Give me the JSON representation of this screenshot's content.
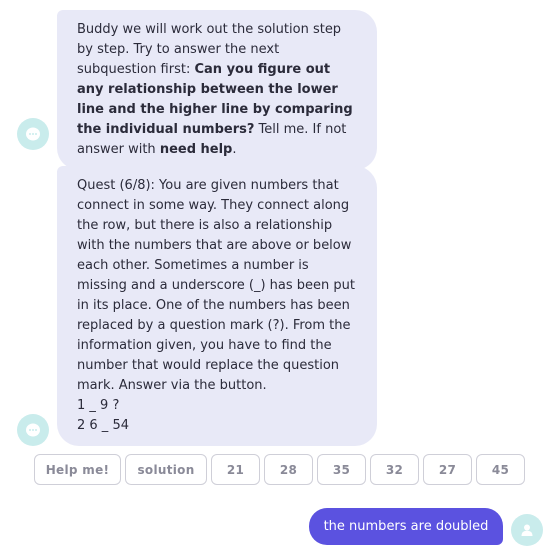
{
  "messages": [
    {
      "sender": "bot",
      "segments": [
        {
          "text": "Buddy we will work out the solution step by step. Try to answer the next subquestion first: ",
          "bold": false
        },
        {
          "text": "Can you figure out any relationship between the lower line and the higher line by comparing the individual numbers?",
          "bold": true
        },
        {
          "text": " Tell me. If not answer with ",
          "bold": false
        },
        {
          "text": "need help",
          "bold": true
        },
        {
          "text": ".",
          "bold": false
        }
      ]
    },
    {
      "sender": "bot",
      "body": "Quest (6/8): You are given numbers that connect in some way. They connect along the row, but there is also a relationship with the numbers that are above or below each other. Sometimes a number is missing and a underscore (_) has been put in its place. One of the numbers has been replaced by a question mark (?). From the information given, you have to find the number that would replace the question mark. Answer via the button.",
      "row1": "1 _ 9 ?",
      "row2": "2 6 _ 54"
    }
  ],
  "quick_replies": [
    "Help me!",
    "solution",
    "21",
    "28",
    "35",
    "32",
    "27",
    "45"
  ],
  "user_message": "the numbers are doubled",
  "colors": {
    "bot_bubble": "#e8e9f7",
    "bot_avatar": "#c9ecec",
    "user_bubble": "#5b52e0",
    "user_avatar": "#c9ecec"
  },
  "icons": {
    "bot_avatar": "chat-bubble-icon",
    "user_avatar": "user-icon"
  }
}
